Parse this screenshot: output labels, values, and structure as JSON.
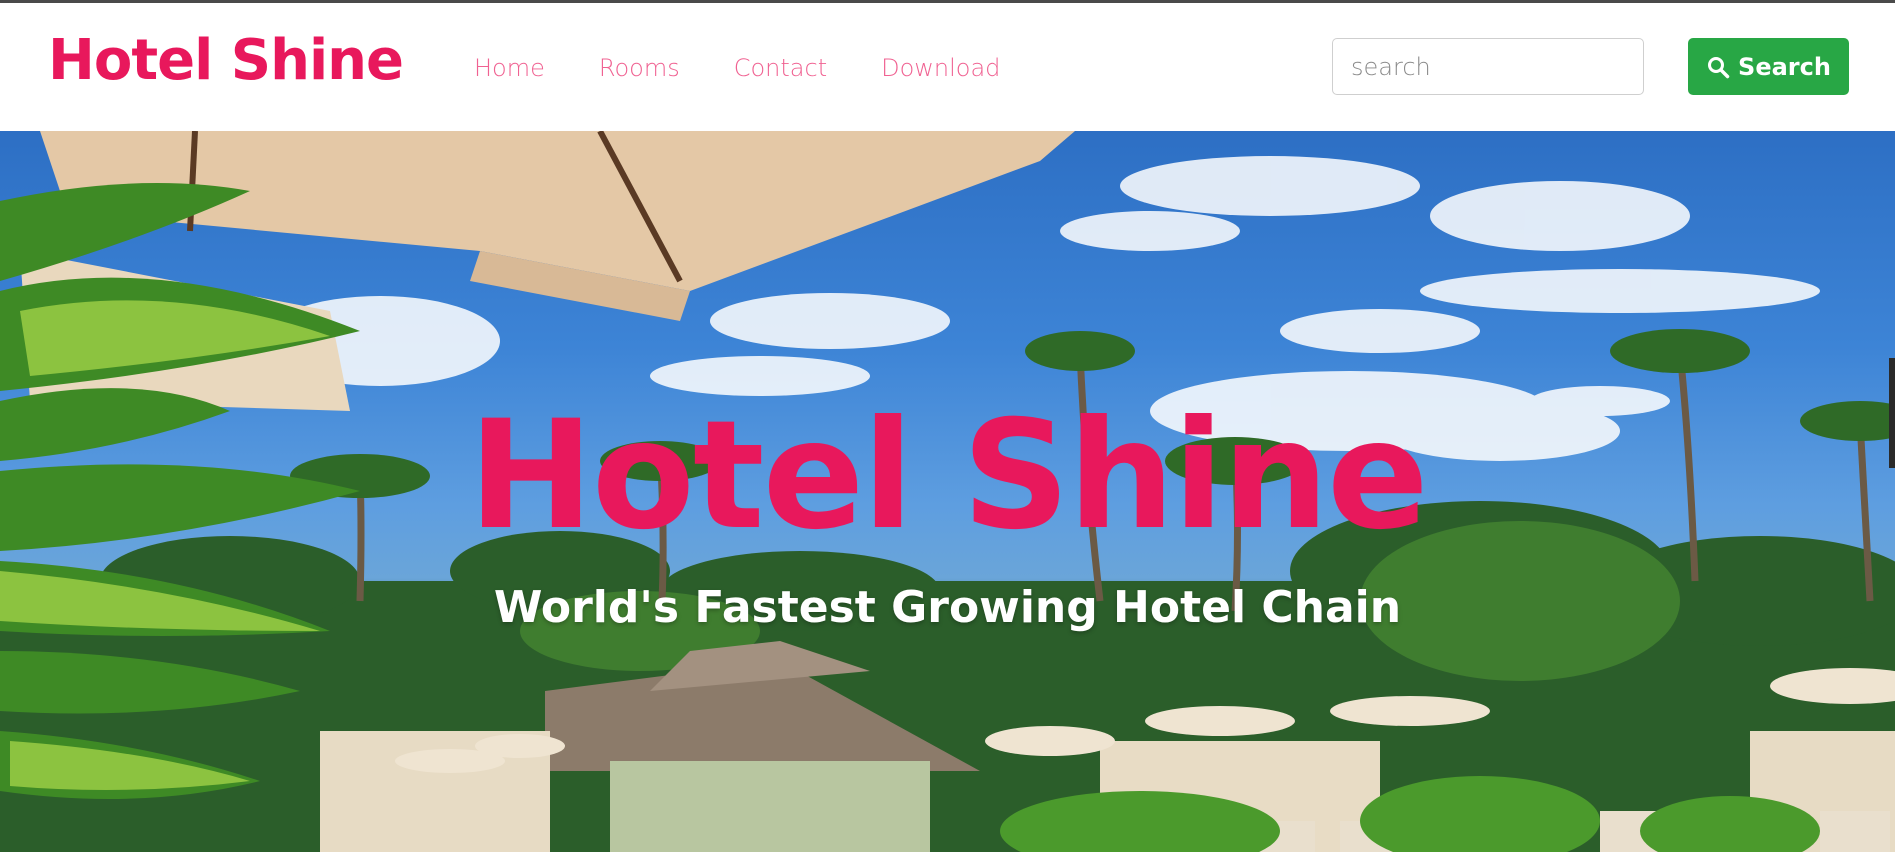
{
  "navbar": {
    "brand": "Hotel Shine",
    "links": [
      "Home",
      "Rooms",
      "Contact",
      "Download"
    ],
    "search": {
      "placeholder": "search",
      "value": ""
    },
    "search_button_label": "Search",
    "search_icon": "search-icon"
  },
  "hero": {
    "title": "Hotel Shine",
    "subtitle": "World's Fastest Growing Hotel Chain"
  },
  "colors": {
    "brand": "#e8185c",
    "nav_link": "#f06292",
    "button_green": "#28a745",
    "white": "#ffffff"
  }
}
